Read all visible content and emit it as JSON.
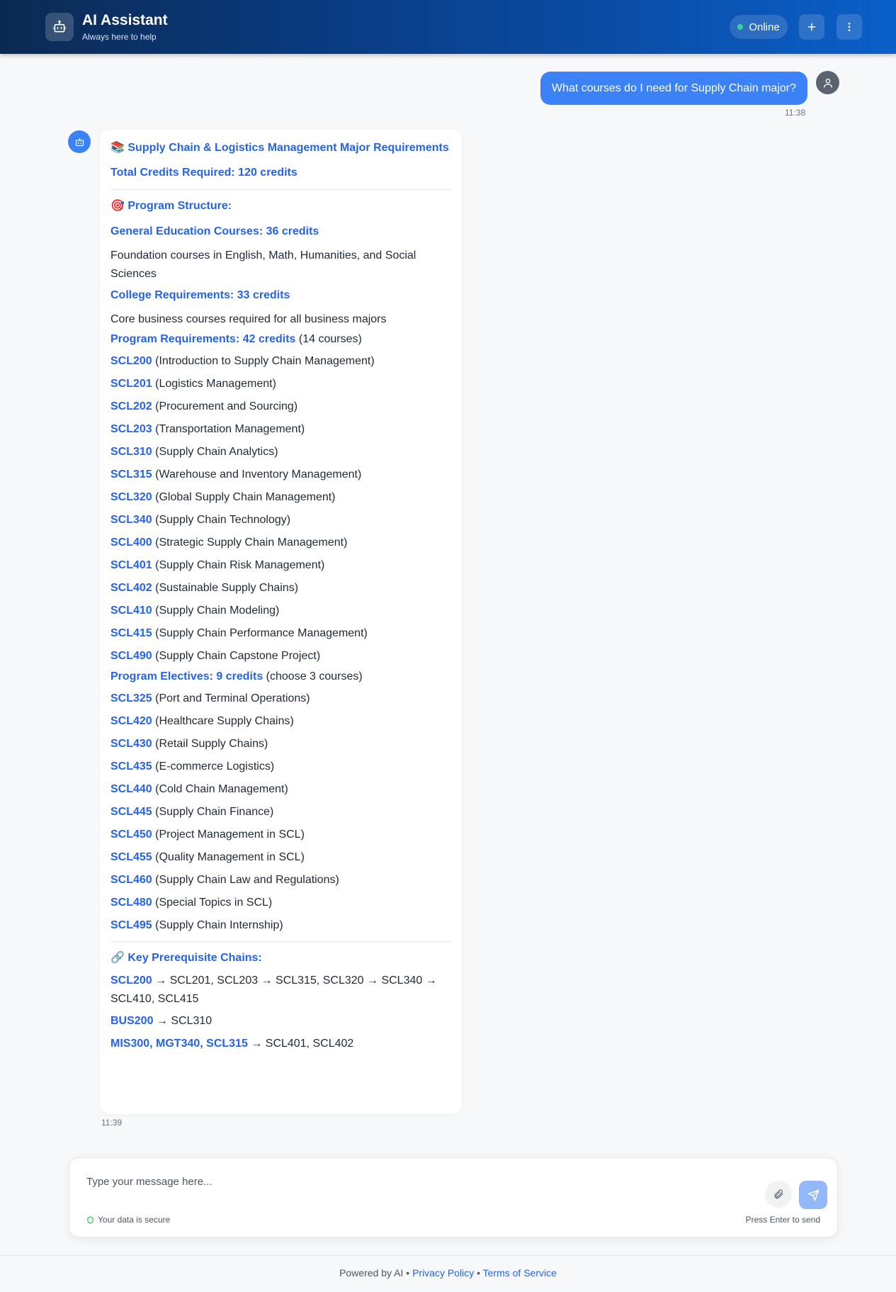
{
  "header": {
    "title": "AI Assistant",
    "subtitle": "Always here to help",
    "status": "Online",
    "new_chat_icon": "plus-icon",
    "menu_icon": "kebab-icon"
  },
  "user_message": {
    "text": "What courses do I need for Supply Chain major?",
    "time": "11:38"
  },
  "bot_message": {
    "title": "📚 Supply Chain & Logistics Management Major Requirements",
    "total_credits": "Total Credits Required: 120 credits",
    "structure_title": "🎯 Program Structure:",
    "gen_ed_title": "General Education Courses: 36 credits",
    "gen_ed_desc": "Foundation courses in English, Math, Humanities, and Social Sciences",
    "college_title": "College Requirements: 33 credits",
    "college_desc": "Core business courses required for all business majors",
    "program_title": "Program Requirements: 42 credits",
    "program_note": " (14 courses)",
    "program_courses": [
      {
        "code": "SCL200",
        "name": " (Introduction to Supply Chain Management)"
      },
      {
        "code": "SCL201",
        "name": " (Logistics Management)"
      },
      {
        "code": "SCL202",
        "name": " (Procurement and Sourcing)"
      },
      {
        "code": "SCL203",
        "name": " (Transportation Management)"
      },
      {
        "code": "SCL310",
        "name": " (Supply Chain Analytics)"
      },
      {
        "code": "SCL315",
        "name": " (Warehouse and Inventory Management)"
      },
      {
        "code": "SCL320",
        "name": " (Global Supply Chain Management)"
      },
      {
        "code": "SCL340",
        "name": " (Supply Chain Technology)"
      },
      {
        "code": "SCL400",
        "name": " (Strategic Supply Chain Management)"
      },
      {
        "code": "SCL401",
        "name": " (Supply Chain Risk Management)"
      },
      {
        "code": "SCL402",
        "name": " (Sustainable Supply Chains)"
      },
      {
        "code": "SCL410",
        "name": " (Supply Chain Modeling)"
      },
      {
        "code": "SCL415",
        "name": " (Supply Chain Performance Management)"
      },
      {
        "code": "SCL490",
        "name": " (Supply Chain Capstone Project)"
      }
    ],
    "electives_title": "Program Electives: 9 credits",
    "electives_note": " (choose 3 courses)",
    "elective_courses": [
      {
        "code": "SCL325",
        "name": " (Port and Terminal Operations)"
      },
      {
        "code": "SCL420",
        "name": " (Healthcare Supply Chains)"
      },
      {
        "code": "SCL430",
        "name": " (Retail Supply Chains)"
      },
      {
        "code": "SCL435",
        "name": " (E-commerce Logistics)"
      },
      {
        "code": "SCL440",
        "name": " (Cold Chain Management)"
      },
      {
        "code": "SCL445",
        "name": " (Supply Chain Finance)"
      },
      {
        "code": "SCL450",
        "name": " (Project Management in SCL)"
      },
      {
        "code": "SCL455",
        "name": " (Quality Management in SCL)"
      },
      {
        "code": "SCL460",
        "name": " (Supply Chain Law and Regulations)"
      },
      {
        "code": "SCL480",
        "name": " (Special Topics in SCL)"
      },
      {
        "code": "SCL495",
        "name": " (Supply Chain Internship)"
      }
    ],
    "prereq_title": "🔗 Key Prerequisite Chains:",
    "prereq_1_code": "SCL200",
    "prereq_1_rest": " → SCL201, SCL203 → SCL315, SCL320 → SCL340 → SCL410, SCL415",
    "prereq_2_code": "BUS200",
    "prereq_2_rest": " → SCL310",
    "prereq_3_code_a": "MIS300",
    "prereq_3_code_b": "MGT340",
    "prereq_3_code_c": "SCL315",
    "prereq_3_sep": ", ",
    "prereq_3_rest": " → SCL401, SCL402",
    "time": "11:39"
  },
  "composer": {
    "placeholder": "Type your message here...",
    "secure_text": "Your data is secure",
    "hint": "Press Enter to send"
  },
  "footer": {
    "prefix": "Powered by AI",
    "sep": " • ",
    "privacy": "Privacy Policy",
    "terms": "Terms of Service"
  },
  "colors": {
    "accent": "#2563eb",
    "user_bubble": "#3b82f6",
    "online": "#34d399"
  }
}
